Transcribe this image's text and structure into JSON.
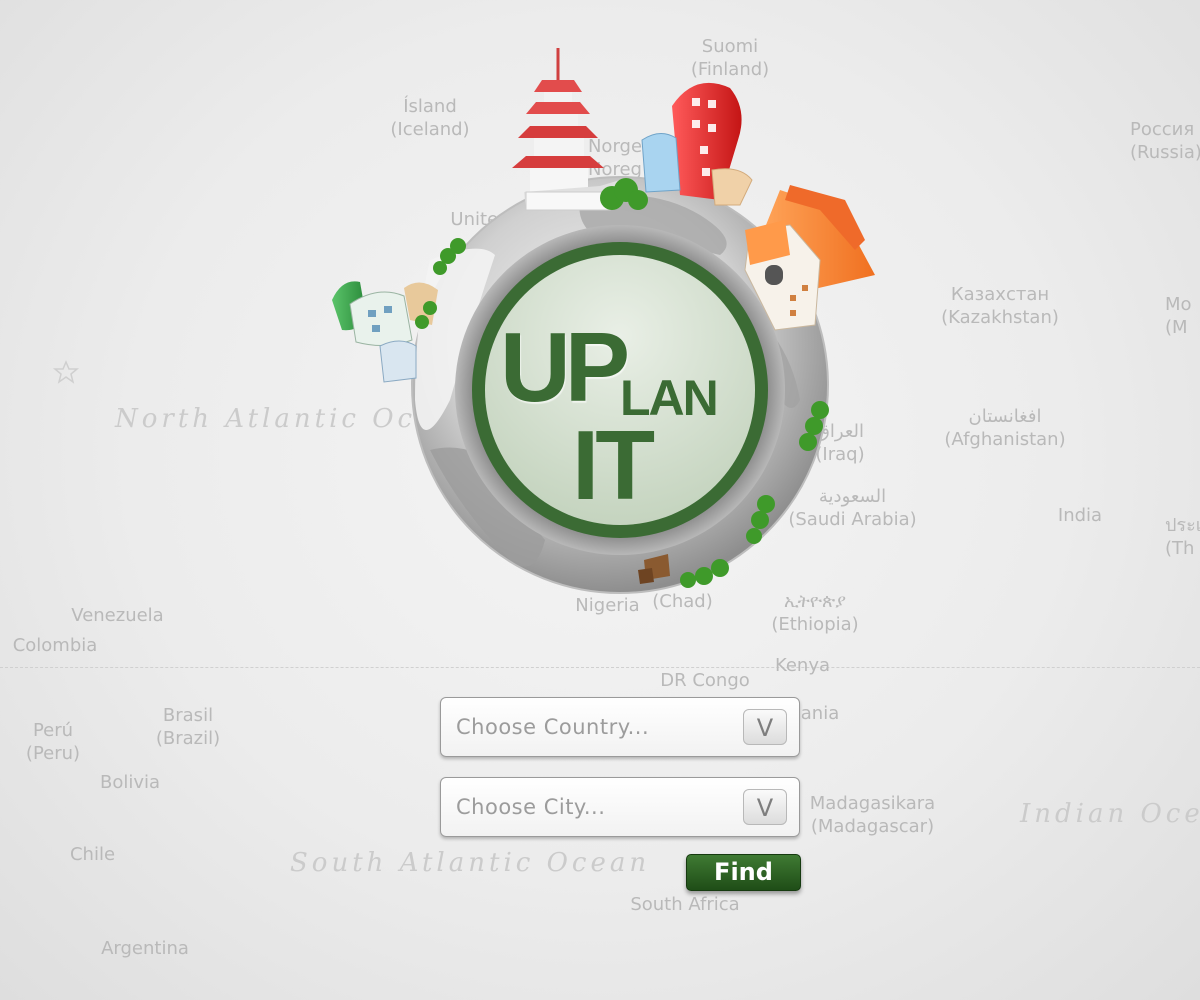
{
  "map": {
    "labels": [
      {
        "id": "suomi",
        "line1": "Suomi",
        "line2": "(Finland)"
      },
      {
        "id": "island",
        "line1": "Ísland",
        "line2": "(Iceland)"
      },
      {
        "id": "russia",
        "line1": "Россия",
        "line2": "(Russia)"
      },
      {
        "id": "norge",
        "line1": "Norge",
        "line2": "Noreg"
      },
      {
        "id": "united",
        "line1": "United",
        "line2": ""
      },
      {
        "id": "kazakhstan",
        "line1": "Казахстан",
        "line2": "(Kazakhstan)"
      },
      {
        "id": "mongolia",
        "line1": "Mo",
        "line2": "(M"
      },
      {
        "id": "afghanistan",
        "line1": "افغانستان",
        "line2": "(Afghanistan)"
      },
      {
        "id": "iraq",
        "line1": "العراق",
        "line2": "(Iraq)"
      },
      {
        "id": "saudi",
        "line1": "السعودية",
        "line2": "(Saudi Arabia)"
      },
      {
        "id": "india",
        "line1": "India",
        "line2": ""
      },
      {
        "id": "thailand",
        "line1": "ประเทศ",
        "line2": "(Th"
      },
      {
        "id": "ethiopia",
        "line1": "ኢትዮጵያ",
        "line2": "(Ethiopia)"
      },
      {
        "id": "chad",
        "line1": "(Chad)",
        "line2": ""
      },
      {
        "id": "nigeria",
        "line1": "Nigeria",
        "line2": ""
      },
      {
        "id": "kenya",
        "line1": "Kenya",
        "line2": ""
      },
      {
        "id": "drcongo",
        "line1": "DR Congo",
        "line2": ""
      },
      {
        "id": "tanzania",
        "line1": "ania",
        "line2": ""
      },
      {
        "id": "madagascar",
        "line1": "Madagasikara",
        "line2": "(Madagascar)"
      },
      {
        "id": "southafrica",
        "line1": "South Africa",
        "line2": ""
      },
      {
        "id": "venezuela",
        "line1": "Venezuela",
        "line2": ""
      },
      {
        "id": "colombia",
        "line1": "Colombia",
        "line2": ""
      },
      {
        "id": "peru",
        "line1": "Perú",
        "line2": "(Peru)"
      },
      {
        "id": "brasil",
        "line1": "Brasil",
        "line2": "(Brazil)"
      },
      {
        "id": "bolivia",
        "line1": "Bolivia",
        "line2": ""
      },
      {
        "id": "chile",
        "line1": "Chile",
        "line2": ""
      },
      {
        "id": "argentina",
        "line1": "Argentina",
        "line2": ""
      }
    ],
    "oceans": {
      "north_atlantic": "North Atlantic Ocean",
      "south_atlantic": "South Atlantic Ocean",
      "indian": "Indian Ocean"
    }
  },
  "logo": {
    "word_up": "UP",
    "word_lan": "LAN",
    "word_it": "IT",
    "colors": {
      "brand_green": "#3b6b34",
      "light_green": "#cfdcc9"
    }
  },
  "form": {
    "country_select": {
      "selected": "Choose Country...",
      "arrow": "V"
    },
    "city_select": {
      "selected": "Choose City...",
      "arrow": "V"
    },
    "find_label": "Find"
  }
}
